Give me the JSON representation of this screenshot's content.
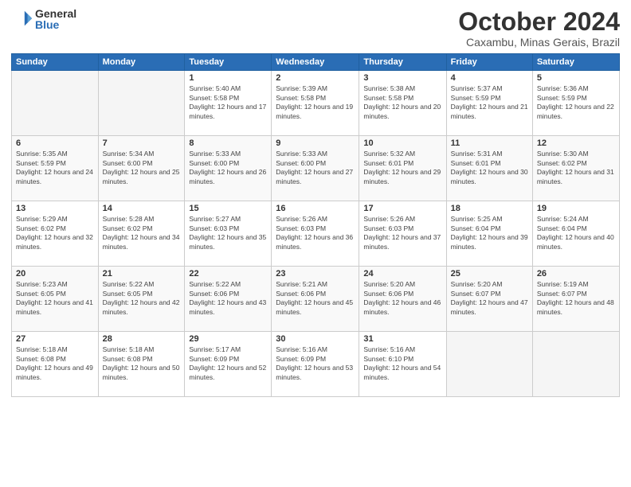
{
  "logo": {
    "general": "General",
    "blue": "Blue"
  },
  "title": "October 2024",
  "location": "Caxambu, Minas Gerais, Brazil",
  "days_of_week": [
    "Sunday",
    "Monday",
    "Tuesday",
    "Wednesday",
    "Thursday",
    "Friday",
    "Saturday"
  ],
  "weeks": [
    [
      {
        "day": null
      },
      {
        "day": null
      },
      {
        "day": "1",
        "sunrise": "5:40 AM",
        "sunset": "5:58 PM",
        "daylight": "12 hours and 17 minutes."
      },
      {
        "day": "2",
        "sunrise": "5:39 AM",
        "sunset": "5:58 PM",
        "daylight": "12 hours and 19 minutes."
      },
      {
        "day": "3",
        "sunrise": "5:38 AM",
        "sunset": "5:58 PM",
        "daylight": "12 hours and 20 minutes."
      },
      {
        "day": "4",
        "sunrise": "5:37 AM",
        "sunset": "5:59 PM",
        "daylight": "12 hours and 21 minutes."
      },
      {
        "day": "5",
        "sunrise": "5:36 AM",
        "sunset": "5:59 PM",
        "daylight": "12 hours and 22 minutes."
      }
    ],
    [
      {
        "day": "6",
        "sunrise": "5:35 AM",
        "sunset": "5:59 PM",
        "daylight": "12 hours and 24 minutes."
      },
      {
        "day": "7",
        "sunrise": "5:34 AM",
        "sunset": "6:00 PM",
        "daylight": "12 hours and 25 minutes."
      },
      {
        "day": "8",
        "sunrise": "5:33 AM",
        "sunset": "6:00 PM",
        "daylight": "12 hours and 26 minutes."
      },
      {
        "day": "9",
        "sunrise": "5:33 AM",
        "sunset": "6:00 PM",
        "daylight": "12 hours and 27 minutes."
      },
      {
        "day": "10",
        "sunrise": "5:32 AM",
        "sunset": "6:01 PM",
        "daylight": "12 hours and 29 minutes."
      },
      {
        "day": "11",
        "sunrise": "5:31 AM",
        "sunset": "6:01 PM",
        "daylight": "12 hours and 30 minutes."
      },
      {
        "day": "12",
        "sunrise": "5:30 AM",
        "sunset": "6:02 PM",
        "daylight": "12 hours and 31 minutes."
      }
    ],
    [
      {
        "day": "13",
        "sunrise": "5:29 AM",
        "sunset": "6:02 PM",
        "daylight": "12 hours and 32 minutes."
      },
      {
        "day": "14",
        "sunrise": "5:28 AM",
        "sunset": "6:02 PM",
        "daylight": "12 hours and 34 minutes."
      },
      {
        "day": "15",
        "sunrise": "5:27 AM",
        "sunset": "6:03 PM",
        "daylight": "12 hours and 35 minutes."
      },
      {
        "day": "16",
        "sunrise": "5:26 AM",
        "sunset": "6:03 PM",
        "daylight": "12 hours and 36 minutes."
      },
      {
        "day": "17",
        "sunrise": "5:26 AM",
        "sunset": "6:03 PM",
        "daylight": "12 hours and 37 minutes."
      },
      {
        "day": "18",
        "sunrise": "5:25 AM",
        "sunset": "6:04 PM",
        "daylight": "12 hours and 39 minutes."
      },
      {
        "day": "19",
        "sunrise": "5:24 AM",
        "sunset": "6:04 PM",
        "daylight": "12 hours and 40 minutes."
      }
    ],
    [
      {
        "day": "20",
        "sunrise": "5:23 AM",
        "sunset": "6:05 PM",
        "daylight": "12 hours and 41 minutes."
      },
      {
        "day": "21",
        "sunrise": "5:22 AM",
        "sunset": "6:05 PM",
        "daylight": "12 hours and 42 minutes."
      },
      {
        "day": "22",
        "sunrise": "5:22 AM",
        "sunset": "6:06 PM",
        "daylight": "12 hours and 43 minutes."
      },
      {
        "day": "23",
        "sunrise": "5:21 AM",
        "sunset": "6:06 PM",
        "daylight": "12 hours and 45 minutes."
      },
      {
        "day": "24",
        "sunrise": "5:20 AM",
        "sunset": "6:06 PM",
        "daylight": "12 hours and 46 minutes."
      },
      {
        "day": "25",
        "sunrise": "5:20 AM",
        "sunset": "6:07 PM",
        "daylight": "12 hours and 47 minutes."
      },
      {
        "day": "26",
        "sunrise": "5:19 AM",
        "sunset": "6:07 PM",
        "daylight": "12 hours and 48 minutes."
      }
    ],
    [
      {
        "day": "27",
        "sunrise": "5:18 AM",
        "sunset": "6:08 PM",
        "daylight": "12 hours and 49 minutes."
      },
      {
        "day": "28",
        "sunrise": "5:18 AM",
        "sunset": "6:08 PM",
        "daylight": "12 hours and 50 minutes."
      },
      {
        "day": "29",
        "sunrise": "5:17 AM",
        "sunset": "6:09 PM",
        "daylight": "12 hours and 52 minutes."
      },
      {
        "day": "30",
        "sunrise": "5:16 AM",
        "sunset": "6:09 PM",
        "daylight": "12 hours and 53 minutes."
      },
      {
        "day": "31",
        "sunrise": "5:16 AM",
        "sunset": "6:10 PM",
        "daylight": "12 hours and 54 minutes."
      },
      {
        "day": null
      },
      {
        "day": null
      }
    ]
  ]
}
